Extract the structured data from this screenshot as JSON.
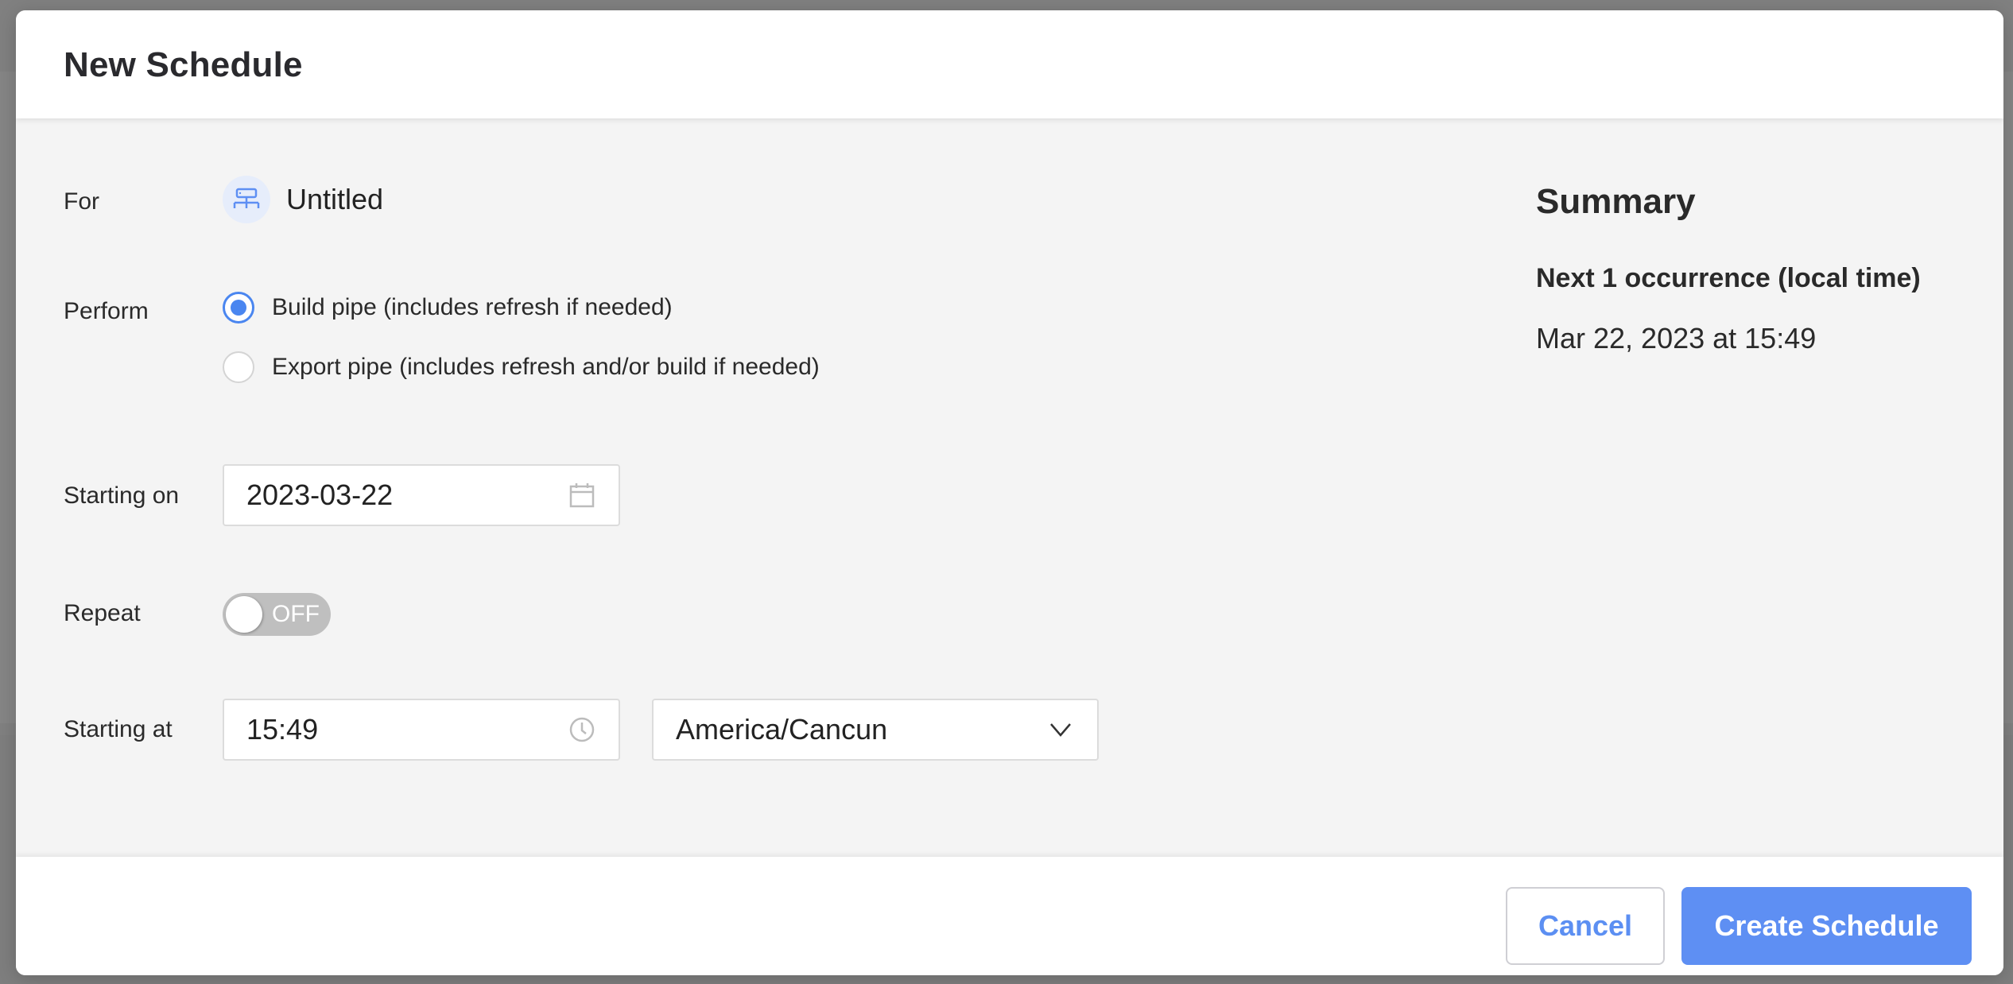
{
  "modal": {
    "title": "New Schedule"
  },
  "form": {
    "for_label": "For",
    "for_value": "Untitled",
    "for_icon": "pipe-icon",
    "perform_label": "Perform",
    "perform_options": [
      {
        "label": "Build pipe (includes refresh if needed)",
        "selected": true
      },
      {
        "label": "Export pipe (includes refresh and/or build if needed)",
        "selected": false
      }
    ],
    "starting_on_label": "Starting on",
    "starting_on_value": "2023-03-22",
    "starting_on_icon": "calendar-icon",
    "repeat_label": "Repeat",
    "repeat_state": "OFF",
    "starting_at_label": "Starting at",
    "starting_at_value": "15:49",
    "starting_at_icon": "clock-icon",
    "timezone_value": "America/Cancun",
    "timezone_icon": "chevron-down-icon"
  },
  "summary": {
    "title": "Summary",
    "subtitle": "Next 1 occurrence (local time)",
    "occurrences": [
      "Mar 22, 2023 at 15:49"
    ]
  },
  "footer": {
    "cancel_label": "Cancel",
    "create_label": "Create Schedule"
  },
  "colors": {
    "accent": "#5e8ff3",
    "body_bg": "#f4f4f4",
    "toggle_off": "#bfbfbf"
  }
}
